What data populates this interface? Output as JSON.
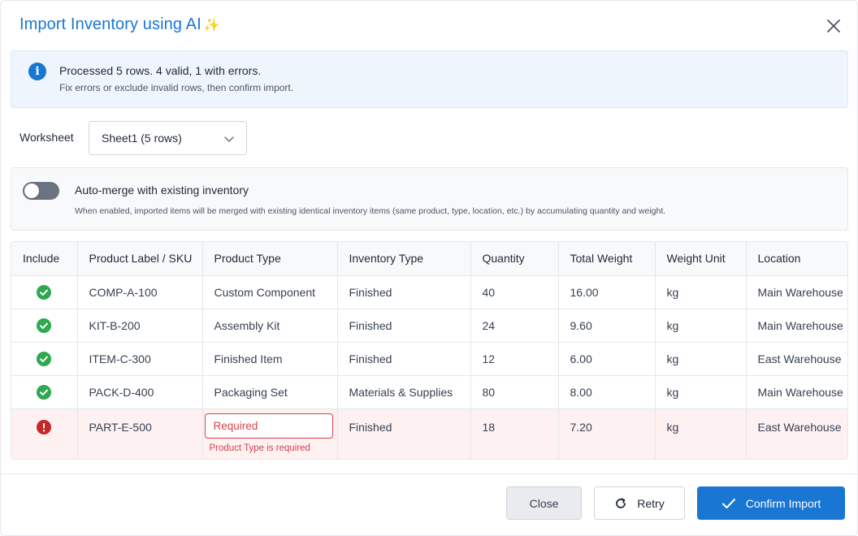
{
  "dialog": {
    "title": "Import Inventory using AI",
    "title_icon": "sparkle-icon",
    "close_icon": "close-icon"
  },
  "info": {
    "icon": "info-icon",
    "main": "Processed 5 rows. 4 valid, 1 with errors.",
    "sub": "Fix errors or exclude invalid rows, then confirm import."
  },
  "worksheet": {
    "label": "Worksheet",
    "selected": "Sheet1 (5 rows)"
  },
  "merge": {
    "enabled": false,
    "title": "Auto-merge with existing inventory",
    "description": "When enabled, imported items will be merged with existing identical inventory items (same product, type, location, etc.) by accumulating quantity and weight."
  },
  "table": {
    "headers": [
      "Include",
      "Product Label / SKU",
      "Product Type",
      "Inventory Type",
      "Quantity",
      "Total Weight",
      "Weight Unit",
      "Location"
    ],
    "rows": [
      {
        "status": "valid",
        "sku": "COMP-A-100",
        "product_type": "Custom Component",
        "inventory_type": "Finished",
        "quantity": "40",
        "weight": "16.00",
        "unit": "kg",
        "location": "Main Warehouse"
      },
      {
        "status": "valid",
        "sku": "KIT-B-200",
        "product_type": "Assembly Kit",
        "inventory_type": "Finished",
        "quantity": "24",
        "weight": "9.60",
        "unit": "kg",
        "location": "Main Warehouse"
      },
      {
        "status": "valid",
        "sku": "ITEM-C-300",
        "product_type": "Finished Item",
        "inventory_type": "Finished",
        "quantity": "12",
        "weight": "6.00",
        "unit": "kg",
        "location": "East Warehouse"
      },
      {
        "status": "valid",
        "sku": "PACK-D-400",
        "product_type": "Packaging Set",
        "inventory_type": "Materials & Supplies",
        "quantity": "80",
        "weight": "8.00",
        "unit": "kg",
        "location": "Main Warehouse"
      },
      {
        "status": "error",
        "sku": "PART-E-500",
        "product_type_placeholder": "Required",
        "product_type_error": "Product Type is required",
        "inventory_type": "Finished",
        "quantity": "18",
        "weight": "7.20",
        "unit": "kg",
        "location": "East Warehouse"
      }
    ]
  },
  "footer": {
    "close_label": "Close",
    "retry_label": "Retry",
    "confirm_label": "Confirm Import"
  },
  "colors": {
    "primary": "#1976d2",
    "success": "#2fa84f",
    "error": "#c62828",
    "error_text": "#d6434a",
    "error_row_bg": "#fdf1f2",
    "info_bg": "#eef5fd"
  }
}
